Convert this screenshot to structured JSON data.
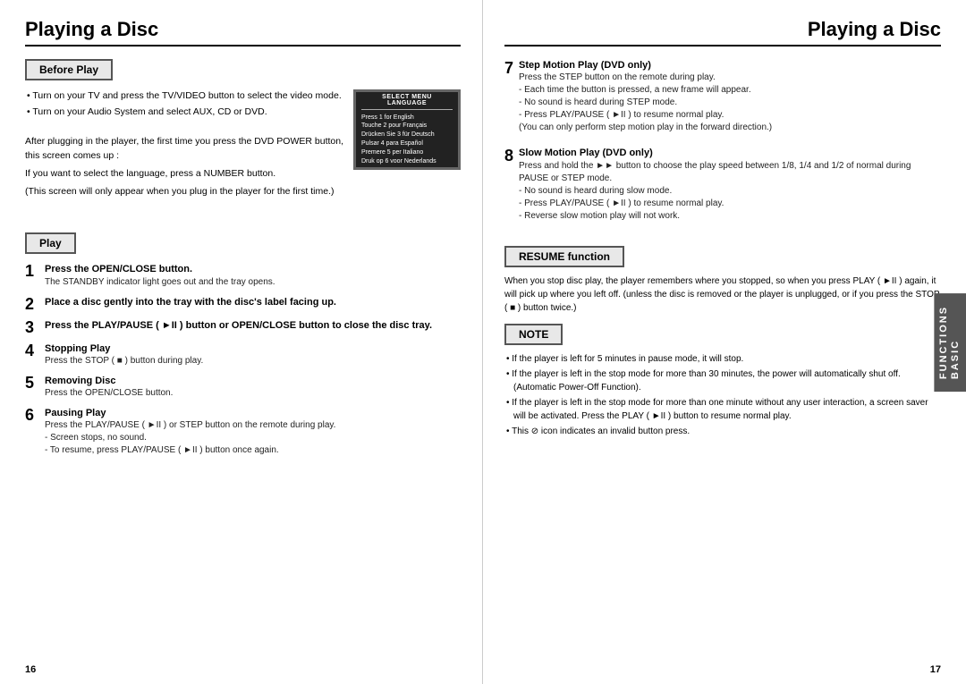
{
  "left": {
    "title": "Playing a Disc",
    "page_num": "16",
    "before_play": {
      "label": "Before Play",
      "bullets": [
        "Turn on your TV and press the TV/VIDEO button to select the video mode.",
        "Turn on your Audio System and select AUX, CD or DVD."
      ],
      "paragraph1": "After plugging in the player, the first time you press the DVD POWER button, this screen comes up :",
      "paragraph2": "If you want to select the language, press a NUMBER button.",
      "paragraph3": "(This screen will only appear when you plug in the player for the first time.)"
    },
    "tv_screen": {
      "title": "SELECT MENU LANGUAGE",
      "rows": [
        "Press  1  for English",
        "Touche  2  pour Français",
        "Drücken Sie  3  für Deutsch",
        "Pulsar  4  para Español",
        "Premere  5  per Italiano",
        "Druk op  6  voor Nederlands"
      ]
    },
    "play_label": "Play",
    "steps": [
      {
        "num": "1",
        "title": "Press the OPEN/CLOSE button.",
        "desc": "The STANDBY indicator light goes out and the tray opens."
      },
      {
        "num": "2",
        "title": "Place a disc gently into the tray with the disc's label facing up."
      },
      {
        "num": "3",
        "title": "Press the PLAY/PAUSE ( ►II ) button or OPEN/CLOSE button to close the disc tray."
      },
      {
        "num": "4",
        "title": "Stopping Play",
        "desc": "Press the STOP ( ■ ) button during play."
      },
      {
        "num": "5",
        "title": "Removing Disc",
        "desc": "Press the OPEN/CLOSE button."
      },
      {
        "num": "6",
        "title": "Pausing Play",
        "desc": "Press the PLAY/PAUSE ( ►II ) or STEP button on the remote during play.",
        "subs": [
          "- Screen stops, no sound.",
          "- To resume, press PLAY/PAUSE ( ►II ) button once again."
        ]
      }
    ]
  },
  "right": {
    "title": "Playing a Disc",
    "page_num": "17",
    "sidebar_line1": "BASIC",
    "sidebar_line2": "FUNCTIONS",
    "step7": {
      "num": "7",
      "title": "Step Motion Play (DVD only)",
      "desc": "Press the STEP button on the remote during play.",
      "subs": [
        "- Each time the button is pressed, a new frame will appear.",
        "- No sound is heard during STEP mode.",
        "- Press PLAY/PAUSE ( ►II ) to resume normal play.",
        "(You can only perform step motion play in the forward direction.)"
      ]
    },
    "step8": {
      "num": "8",
      "title": "Slow Motion Play (DVD only)",
      "desc": "Press and hold the ►► button to choose the play speed between 1/8, 1/4 and 1/2 of normal during PAUSE or STEP mode.",
      "subs": [
        "- No sound is heard during slow mode.",
        "- Press PLAY/PAUSE ( ►II ) to resume normal play.",
        "- Reverse slow motion play will not work."
      ]
    },
    "resume": {
      "label": "RESUME function",
      "text": "When you stop disc play, the player remembers where you stopped, so when you press PLAY ( ►II ) again, it will pick up where you left off. (unless the disc is removed or the player is unplugged, or if you press the STOP ( ■ ) button twice.)"
    },
    "note": {
      "label": "NOTE",
      "bullets": [
        "If the player is left for 5 minutes in pause mode, it will stop.",
        "If the player is left in the stop mode for more than 30 minutes, the power will automatically shut off. (Automatic Power-Off Function).",
        "If the player is left in the stop mode for more than one minute without any user interaction, a screen saver will be activated. Press the PLAY ( ►II ) button to resume normal play.",
        "This ⊘ icon indicates an invalid button press."
      ]
    }
  }
}
